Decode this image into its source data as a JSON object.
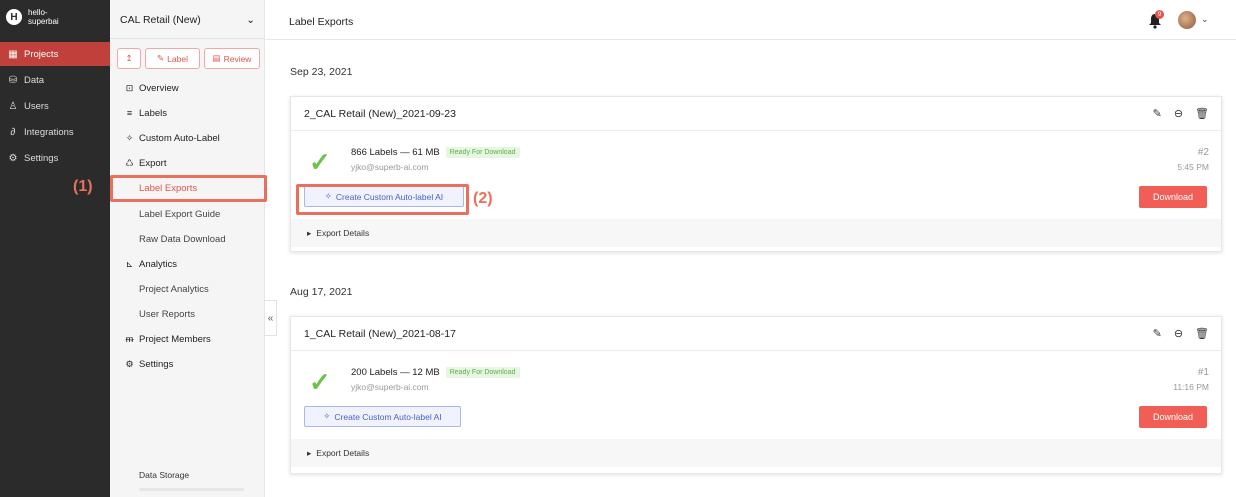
{
  "workspace": {
    "initial": "H",
    "name_line1": "hello-",
    "name_line2": "superbai"
  },
  "rail": [
    {
      "icon": "projects-icon",
      "glyph": "▦",
      "label": "Projects"
    },
    {
      "icon": "data-icon",
      "glyph": "⛁",
      "label": "Data"
    },
    {
      "icon": "users-icon",
      "glyph": "♙",
      "label": "Users"
    },
    {
      "icon": "integrations-icon",
      "glyph": "∂",
      "label": "Integrations"
    },
    {
      "icon": "settings-icon",
      "glyph": "⚙",
      "label": "Settings"
    }
  ],
  "sidebar": {
    "project": "CAL Retail (New)",
    "actions": {
      "upload": "↥",
      "label": "Label",
      "review": "Review"
    },
    "nav": [
      {
        "glyph": "⊡",
        "label": "Overview"
      },
      {
        "glyph": "≡",
        "label": "Labels"
      },
      {
        "glyph": "✧",
        "label": "Custom Auto-Label"
      },
      {
        "glyph": "♺",
        "label": "Export"
      },
      {
        "label": "Label Exports"
      },
      {
        "label": "Label Export Guide"
      },
      {
        "label": "Raw Data Download"
      },
      {
        "glyph": "⊾",
        "label": "Analytics"
      },
      {
        "label": "Project Analytics"
      },
      {
        "label": "User Reports"
      },
      {
        "glyph": "ᵯ",
        "label": "Project Members"
      },
      {
        "glyph": "⚙",
        "label": "Settings"
      }
    ],
    "storage_label": "Data Storage"
  },
  "header": {
    "title": "Label Exports",
    "notifications": "9"
  },
  "annotations": {
    "one": "(1)",
    "two": "(2)"
  },
  "exports": [
    {
      "date": "Sep 23, 2021",
      "name": "2_CAL Retail (New)_2021-09-23",
      "summary": "866 Labels — 61 MB",
      "status": "Ready For Download",
      "email": "yjko@superb-ai.com",
      "number": "#2",
      "time": "5:45 PM",
      "cal_button": "Create Custom Auto-label AI",
      "download": "Download",
      "details": "Export Details"
    },
    {
      "date": "Aug 17, 2021",
      "name": "1_CAL Retail (New)_2021-08-17",
      "summary": "200 Labels — 12 MB",
      "status": "Ready For Download",
      "email": "yjko@superb-ai.com",
      "number": "#1",
      "time": "11:16 PM",
      "cal_button": "Create Custom Auto-label AI",
      "download": "Download",
      "details": "Export Details"
    }
  ],
  "colors": {
    "accent": "#e5534b",
    "highlight": "#e8705c",
    "ready": "#5cae45",
    "rail": "#2b2b2b"
  }
}
